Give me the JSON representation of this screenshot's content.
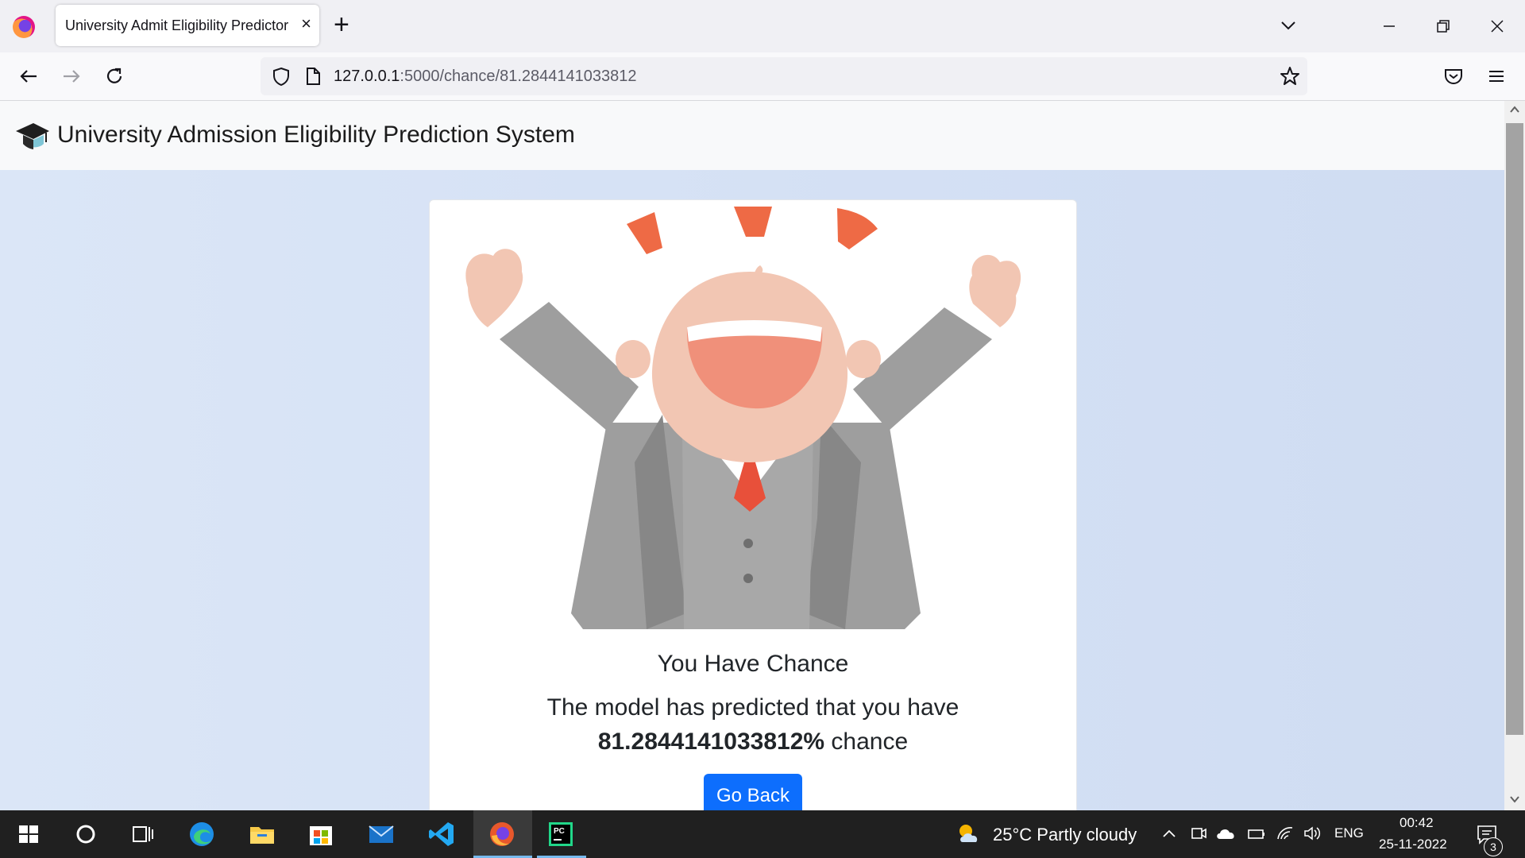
{
  "browser": {
    "tab_title": "University Admit Eligibility Predictor",
    "tab_close": "×",
    "new_tab": "+",
    "url_host": "127.0.0.1",
    "url_rest": ":5000/chance/81.2844141033812"
  },
  "site": {
    "brand": "University Admission Eligibility Prediction System"
  },
  "result": {
    "title": "You Have Chance",
    "line1": "The model has predicted that you have",
    "percent": "81.2844141033812%",
    "suffix": " chance",
    "button": "Go Back"
  },
  "taskbar": {
    "weather": "25°C  Partly cloudy",
    "lang": "ENG",
    "time": "00:42",
    "date": "25-11-2022",
    "notifications": "3"
  },
  "colors": {
    "accent": "#0d6efd",
    "confetti": "#ee6a45",
    "suit": "#9e9e9e",
    "skin": "#f2c6b3",
    "tie": "#e8503a"
  }
}
